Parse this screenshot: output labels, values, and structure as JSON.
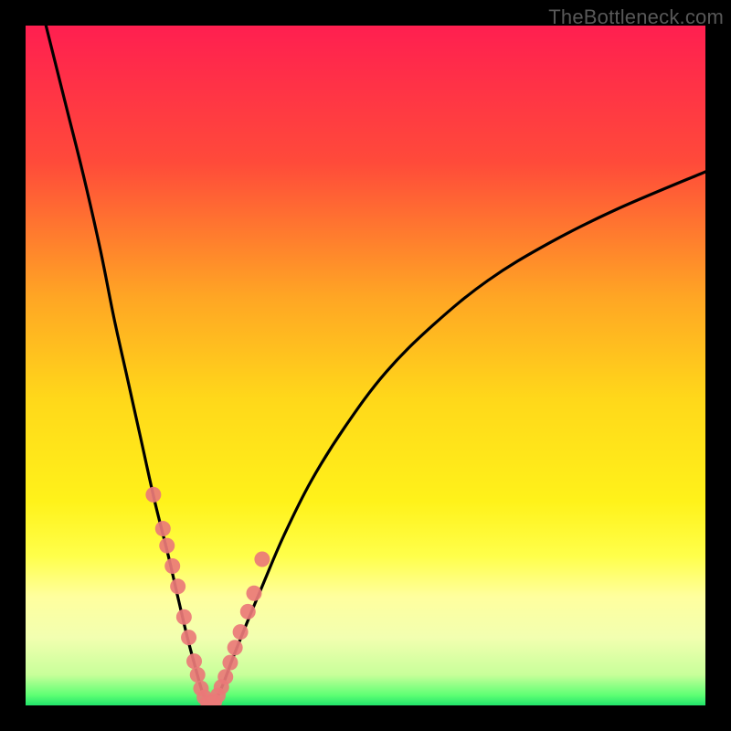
{
  "watermark": "TheBottleneck.com",
  "chart_data": {
    "type": "line",
    "title": "",
    "xlabel": "",
    "ylabel": "",
    "xlim": [
      0,
      100
    ],
    "ylim": [
      0,
      100
    ],
    "grid": false,
    "legend": false,
    "gradient_stops": [
      {
        "offset": 0.0,
        "color": "#ff1f50"
      },
      {
        "offset": 0.2,
        "color": "#ff4a3a"
      },
      {
        "offset": 0.4,
        "color": "#ffa624"
      },
      {
        "offset": 0.55,
        "color": "#ffd81a"
      },
      {
        "offset": 0.7,
        "color": "#fff21a"
      },
      {
        "offset": 0.78,
        "color": "#ffff4a"
      },
      {
        "offset": 0.84,
        "color": "#ffff9e"
      },
      {
        "offset": 0.9,
        "color": "#f2ffb0"
      },
      {
        "offset": 0.955,
        "color": "#c8ff9a"
      },
      {
        "offset": 0.985,
        "color": "#5eff74"
      },
      {
        "offset": 1.0,
        "color": "#21e36a"
      }
    ],
    "series": [
      {
        "name": "bottleneck-curve-left",
        "type": "line",
        "color": "#000000",
        "x": [
          3.0,
          6.0,
          8.5,
          11.0,
          13.0,
          15.0,
          17.0,
          19.0,
          21.0,
          22.5,
          23.8,
          25.0,
          26.0,
          26.8
        ],
        "y": [
          100.0,
          88.0,
          78.0,
          67.0,
          57.0,
          48.0,
          39.0,
          30.0,
          22.0,
          15.5,
          10.0,
          5.5,
          2.0,
          0.5
        ]
      },
      {
        "name": "bottleneck-curve-right",
        "type": "line",
        "color": "#000000",
        "x": [
          27.8,
          29.0,
          30.5,
          32.5,
          35.0,
          38.0,
          42.0,
          47.0,
          53.0,
          60.0,
          68.0,
          77.0,
          87.0,
          100.0
        ],
        "y": [
          0.5,
          3.0,
          7.0,
          12.0,
          18.0,
          25.0,
          33.0,
          41.0,
          49.0,
          56.0,
          62.5,
          68.0,
          73.0,
          78.5
        ]
      },
      {
        "name": "left-branch-markers",
        "type": "scatter",
        "color": "#ea7a78",
        "x": [
          18.8,
          20.2,
          20.8,
          21.6,
          22.4,
          23.3,
          24.0,
          24.8,
          25.3,
          25.8,
          26.3,
          26.8
        ],
        "y": [
          31.0,
          26.0,
          23.5,
          20.5,
          17.5,
          13.0,
          10.0,
          6.5,
          4.5,
          2.5,
          1.2,
          0.5
        ]
      },
      {
        "name": "right-branch-markers",
        "type": "scatter",
        "color": "#ea7a78",
        "x": [
          27.8,
          28.3,
          28.8,
          29.4,
          30.1,
          30.8,
          31.6,
          32.7,
          33.6,
          34.8
        ],
        "y": [
          0.6,
          1.5,
          2.7,
          4.2,
          6.3,
          8.5,
          10.8,
          13.8,
          16.5,
          21.5
        ]
      },
      {
        "name": "bottom-markers",
        "type": "scatter",
        "color": "#ea7a78",
        "x": [
          27.0,
          27.5
        ],
        "y": [
          0.3,
          0.3
        ]
      }
    ]
  }
}
